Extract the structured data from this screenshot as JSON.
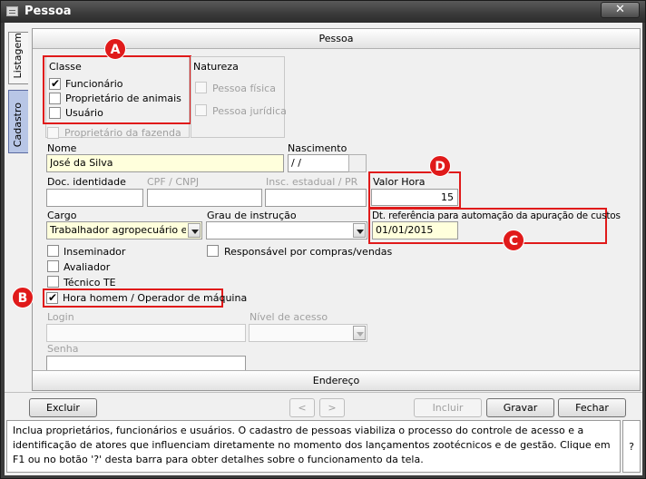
{
  "window": {
    "title": "Pessoa",
    "close_label": "✕"
  },
  "side_tabs": {
    "listagem": "Listagem",
    "cadastro": "Cadastro"
  },
  "panel": {
    "header": "Pessoa",
    "footer": "Endereço"
  },
  "classe": {
    "title": "Classe",
    "items": [
      {
        "label": "Funcionário",
        "checked": true
      },
      {
        "label": "Proprietário de animais",
        "checked": false
      },
      {
        "label": "Usuário",
        "checked": false
      }
    ]
  },
  "natureza": {
    "title": "Natureza",
    "items": [
      {
        "label": "Pessoa física"
      },
      {
        "label": "Pessoa jurídica"
      }
    ]
  },
  "proprietario_fazenda": {
    "label": "Proprietário da fazenda"
  },
  "nome": {
    "label": "Nome",
    "value": "José da Silva"
  },
  "nascimento": {
    "label": "Nascimento",
    "value": " / /"
  },
  "doc_identidade": {
    "label": "Doc. identidade",
    "value": ""
  },
  "cpf": {
    "label": "CPF / CNPJ",
    "value": ""
  },
  "insc": {
    "label": "Insc. estadual / PR",
    "value": ""
  },
  "valor_hora": {
    "label": "Valor Hora",
    "value": "15"
  },
  "cargo": {
    "label": "Cargo",
    "value": "Trabalhador agropecuário em g"
  },
  "grau": {
    "label": "Grau de instrução",
    "value": ""
  },
  "dt_referencia": {
    "label": "Dt. referência para automação da apuração de custos",
    "value": "01/01/2015"
  },
  "checks": {
    "inseminador": "Inseminador",
    "avaliador": "Avaliador",
    "tecnico": "Técnico TE",
    "responsavel": "Responsável por compras/vendas",
    "hora_homem": "Hora homem / Operador de máquina"
  },
  "login": {
    "label": "Login",
    "value": ""
  },
  "nivel": {
    "label": "Nível de acesso",
    "value": ""
  },
  "senha": {
    "label": "Senha",
    "value": ""
  },
  "callouts": {
    "a": "A",
    "b": "B",
    "c": "C",
    "d": "D"
  },
  "buttons": {
    "excluir": "Excluir",
    "prev": "<",
    "next": ">",
    "incluir": "Incluir",
    "gravar": "Gravar",
    "fechar": "Fechar"
  },
  "help": {
    "text": "Inclua proprietários, funcionários e usuários. O cadastro de pessoas viabiliza o processo do controle de acesso e a identificação de atores que influenciam diretamente no momento dos lançamentos zootécnicos e de gestão. Clique em F1 ou no botão '?' desta barra para obter detalhes sobre o funcionamento da tela.",
    "question": "?"
  },
  "colors": {
    "callout_red": "#e01a1a",
    "yellow_field": "#ffffdc",
    "title_bar": "#3a3a3a"
  }
}
